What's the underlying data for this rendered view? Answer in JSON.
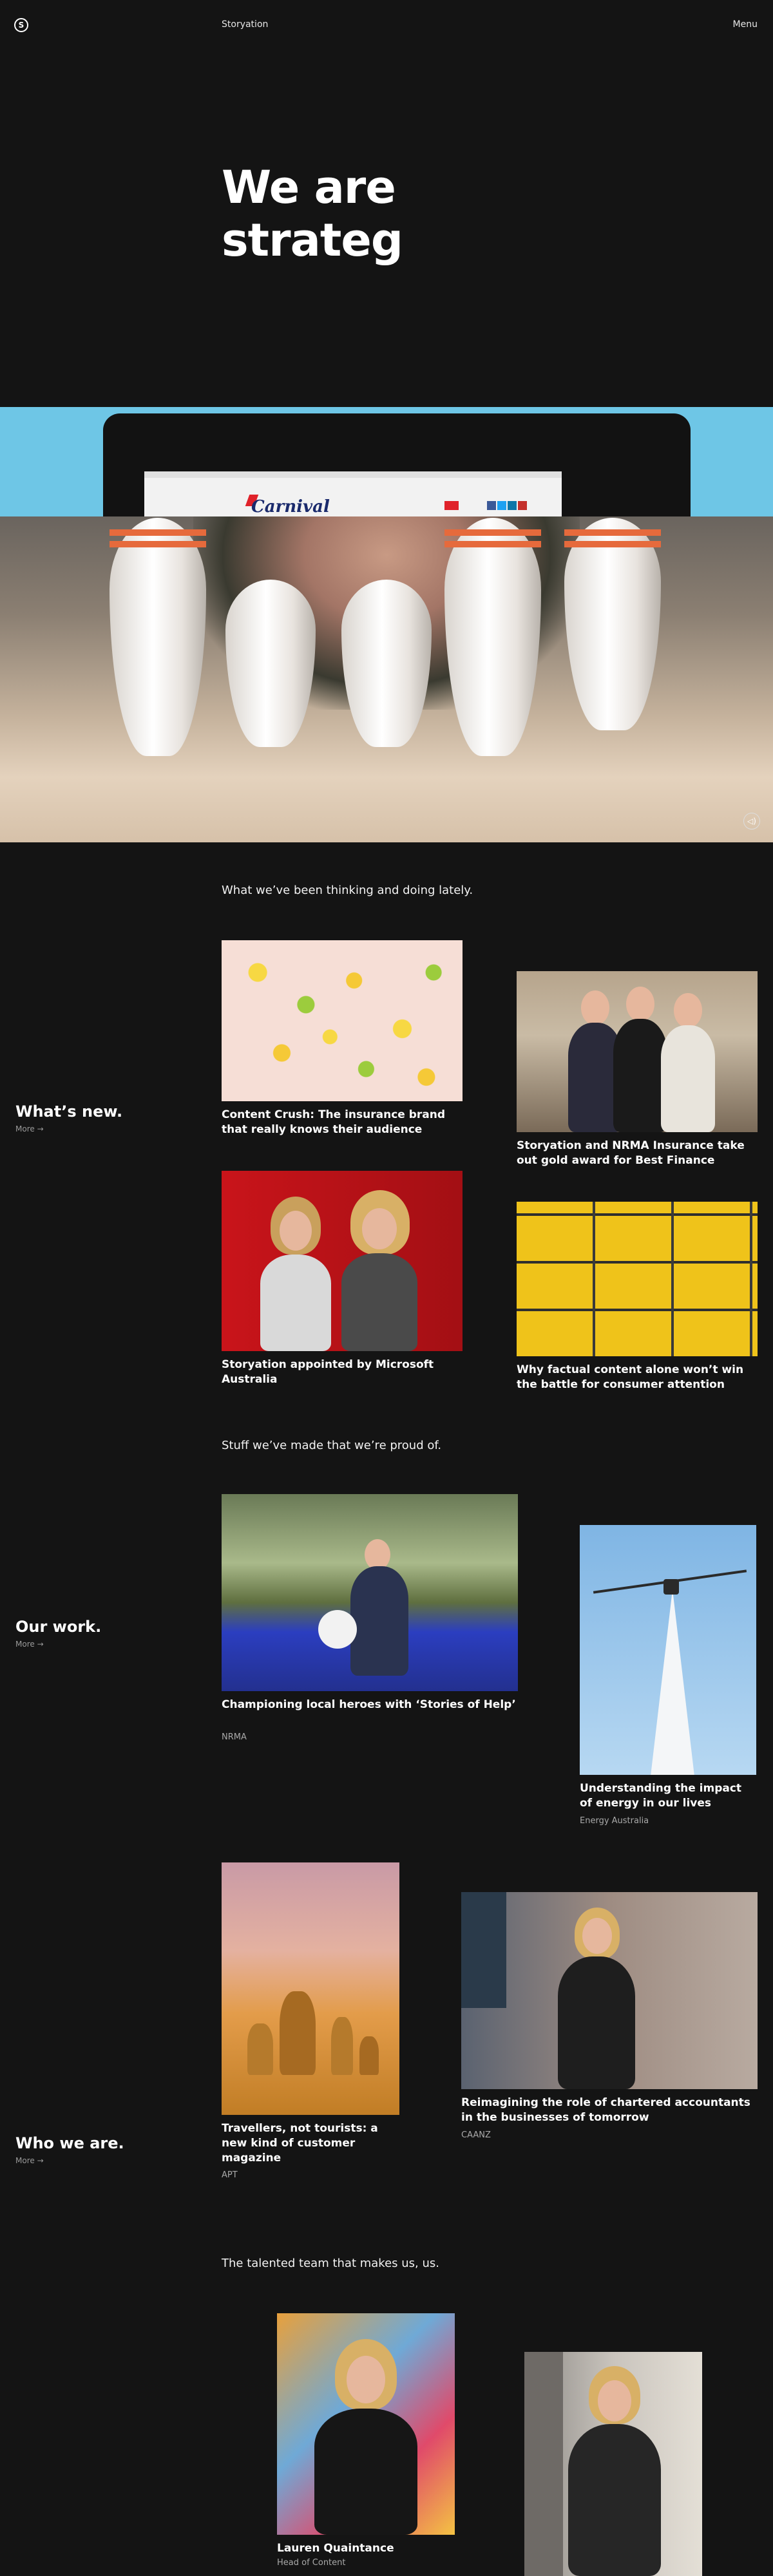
{
  "header": {
    "logo_glyph": "S",
    "brand": "Storyation",
    "menu_label": "Menu"
  },
  "hero": {
    "title_line1": "We are",
    "title_line2": "strateg",
    "screen_brand": "Carnival",
    "sound_glyph": "◁)"
  },
  "whats_new": {
    "intro": "What we’ve been thinking and doing lately.",
    "title": "What’s new.",
    "more": "More →",
    "cards": [
      {
        "title": "Content Crush: The insurance brand that really knows their audience"
      },
      {
        "title": "Storyation and NRMA Insurance take out gold award for Best Finance"
      },
      {
        "title": "Storyation appointed by Microsoft Australia"
      },
      {
        "title": "Why factual content alone won’t win the battle for consumer attention"
      }
    ]
  },
  "our_work": {
    "intro": "Stuff we’ve made that we’re proud of.",
    "title": "Our work.",
    "more": "More →",
    "cards": [
      {
        "title": "Championing local heroes with ‘Stories of Help’",
        "client": "NRMA"
      },
      {
        "title": "Understanding the impact of energy in our lives",
        "client": "Energy Australia"
      },
      {
        "title": "Travellers, not tourists: a new kind of customer magazine",
        "client": "APT"
      },
      {
        "title": "Reimagining the role of chartered accountants in the businesses of tomorrow",
        "client": "CAANZ"
      }
    ]
  },
  "who_we_are": {
    "title": "Who we are.",
    "more": "More →",
    "intro": "The talented team that makes us, us.",
    "team": [
      {
        "name": "Lauren Quaintance",
        "role": "Head of Content"
      }
    ]
  },
  "colors": {
    "background": "#141414",
    "text": "#ffffff",
    "muted": "#a9a9a9",
    "pin_accent": "#e66a3c"
  }
}
